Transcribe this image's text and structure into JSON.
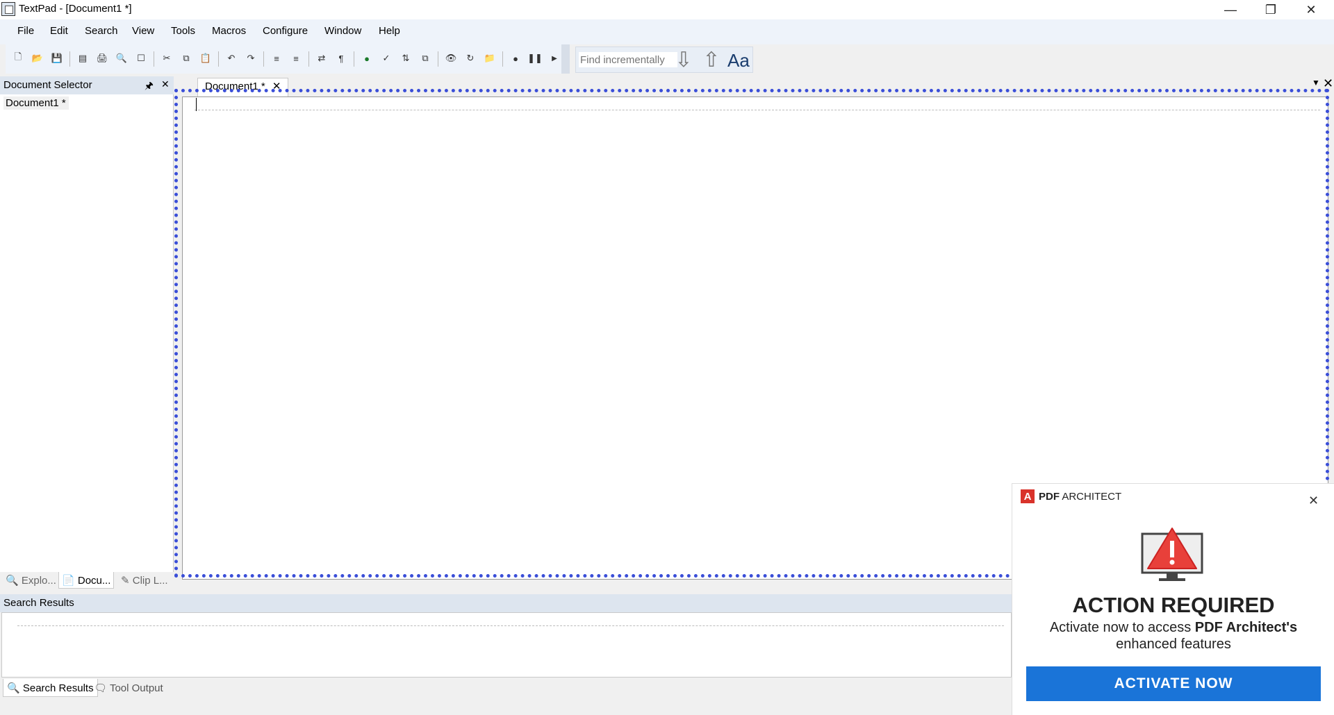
{
  "window": {
    "title": "TextPad - [Document1 *]"
  },
  "menu": [
    "File",
    "Edit",
    "Search",
    "View",
    "Tools",
    "Macros",
    "Configure",
    "Window",
    "Help"
  ],
  "find": {
    "placeholder": "Find incrementally",
    "case_label": "Aa"
  },
  "document_selector": {
    "title": "Document Selector",
    "items": [
      "Document1 *"
    ],
    "tabs": [
      "Explo...",
      "Docu...",
      "Clip L..."
    ]
  },
  "editor": {
    "tab_label": "Document1 *"
  },
  "search_results": {
    "title": "Search Results",
    "tabs": [
      "Search Results",
      "Tool Output"
    ]
  },
  "popup": {
    "brand_bold": "PDF",
    "brand_rest": " ARCHITECT",
    "logo_letter": "A",
    "heading": "ACTION REQUIRED",
    "body_prefix": "Activate now to access ",
    "body_bold": "PDF Architect's",
    "body_suffix": "enhanced features",
    "button": "ACTIVATE NOW",
    "accent": "#1a74d8",
    "alert_color": "#e8403a"
  }
}
